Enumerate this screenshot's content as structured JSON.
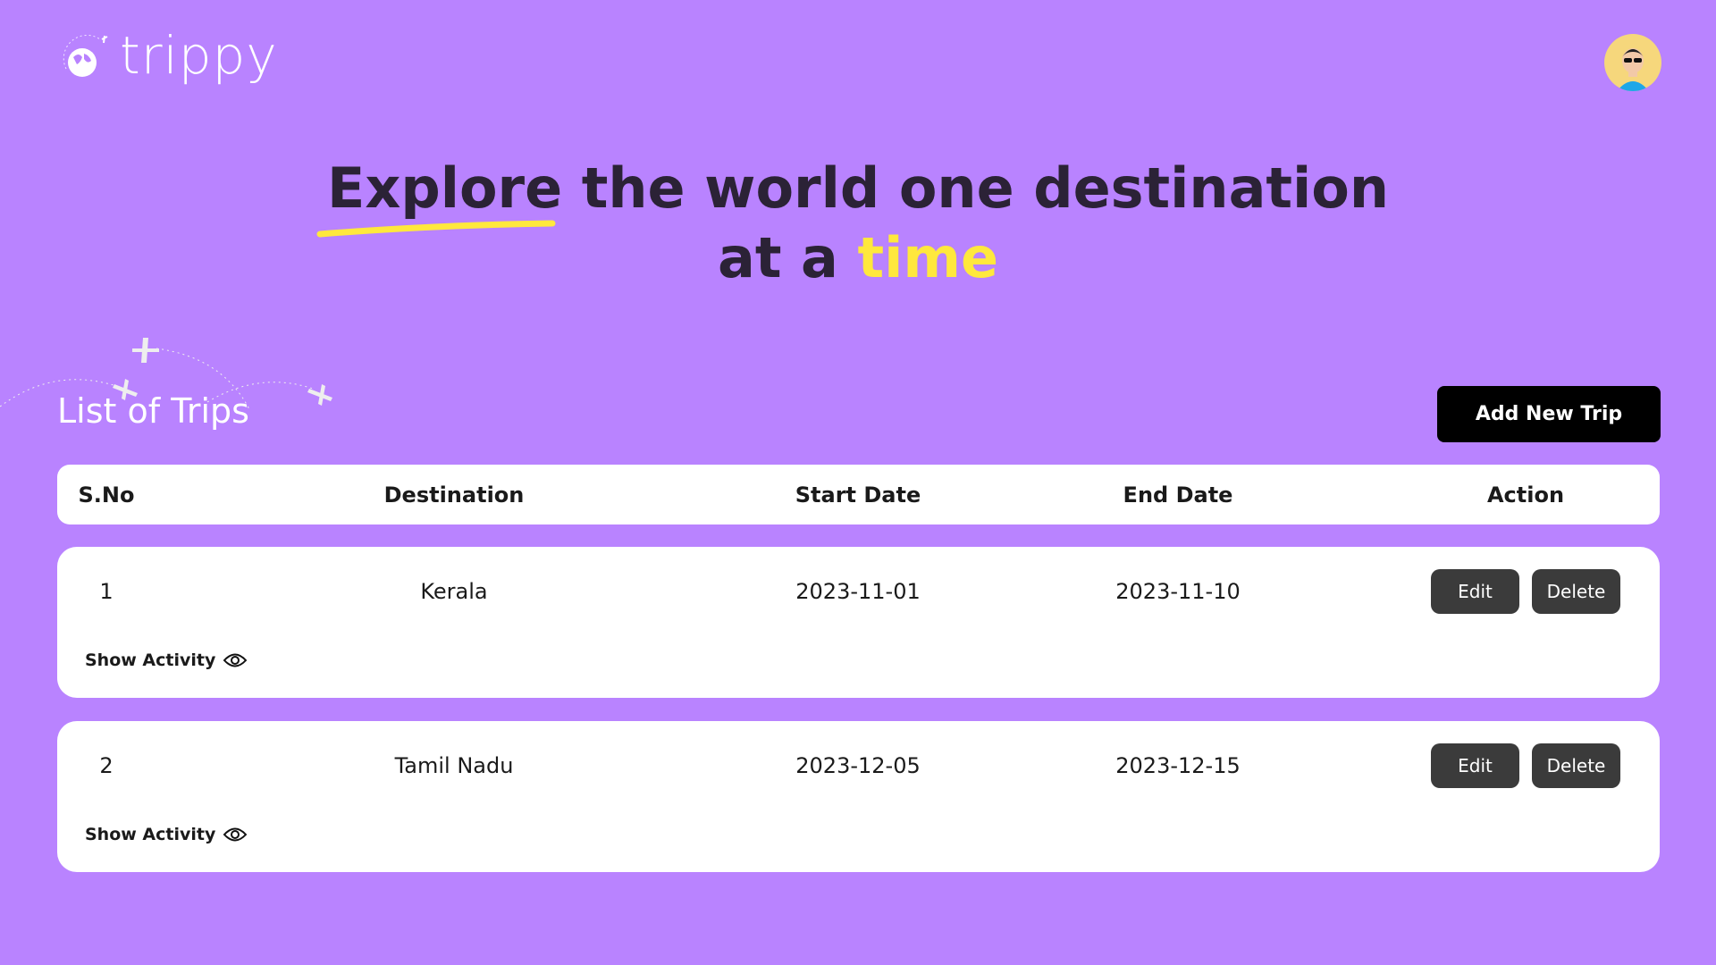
{
  "brand": {
    "name": "trippy"
  },
  "colors": {
    "background": "#b983ff",
    "accent": "#ffe83d",
    "button": "#3b3b3b"
  },
  "headline": {
    "word1": "Explore",
    "rest1": " the world one destination",
    "line2a": "at a ",
    "highlight": "time"
  },
  "list": {
    "title": "List of Trips",
    "add_label": "Add New Trip"
  },
  "table": {
    "headers": [
      "S.No",
      "Destination",
      "Start Date",
      "End Date",
      "Action"
    ],
    "rows": [
      {
        "sno": "1",
        "destination": "Kerala",
        "start": "2023-11-01",
        "end": "2023-11-10",
        "edit": "Edit",
        "delete": "Delete",
        "show": "Show Activity"
      },
      {
        "sno": "2",
        "destination": "Tamil Nadu",
        "start": "2023-12-05",
        "end": "2023-12-15",
        "edit": "Edit",
        "delete": "Delete",
        "show": "Show Activity"
      }
    ]
  }
}
